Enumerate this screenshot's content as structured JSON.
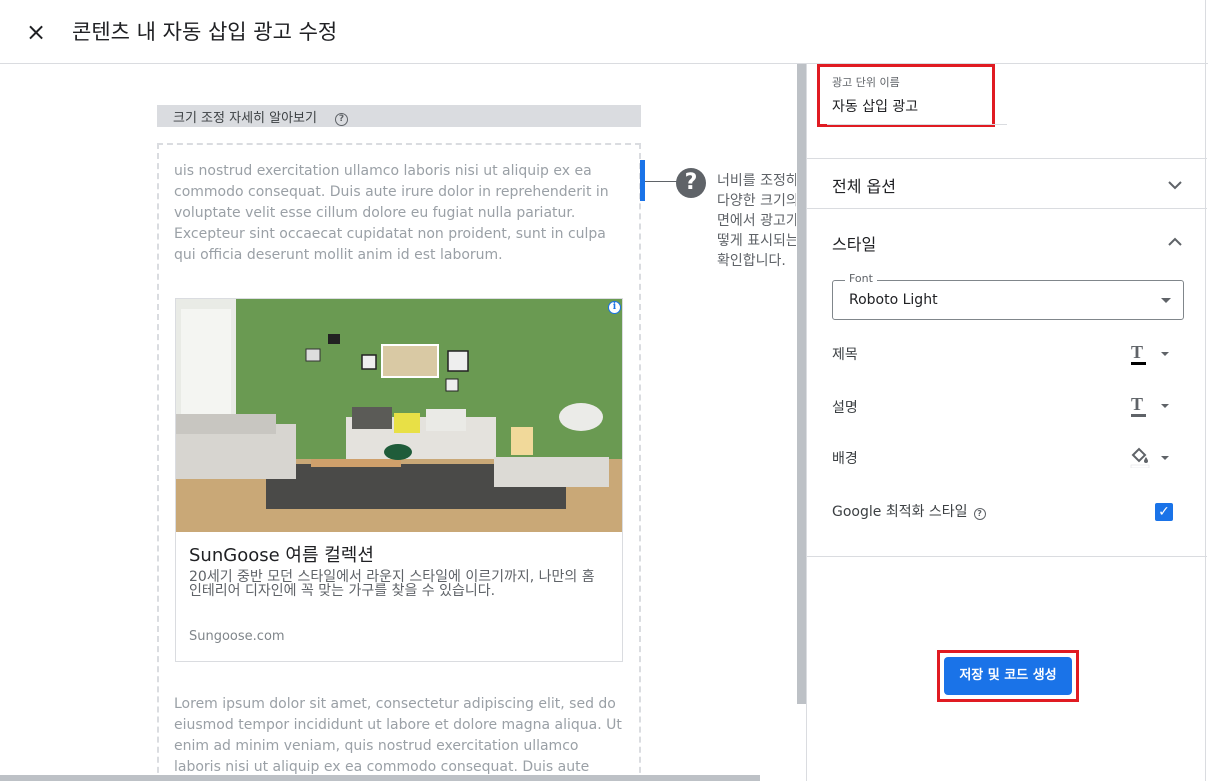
{
  "header": {
    "title": "콘텐츠 내 자동 삽입 광고 수정",
    "close_icon": "×"
  },
  "preview": {
    "resize_link": "크기 조정 자세히 알아보기",
    "lorem_top": "uis nostrud exercitation ullamco laboris nisi ut aliquip ex ea commodo consequat. Duis aute irure dolor in reprehenderit in voluptate velit esse cillum dolore eu fugiat nulla pariatur. Excepteur sint occaecat cupidatat non proident, sunt in culpa qui officia deserunt mollit anim id est laborum.",
    "lorem_bottom": "Lorem ipsum dolor sit amet, consectetur adipiscing elit, sed do eiusmod tempor incididunt ut labore et dolore magna aliqua. Ut enim ad minim veniam, quis nostrud exercitation ullamco laboris nisi ut aliquip ex ea commodo consequat. Duis aute irure dolor in",
    "ad": {
      "title": "SunGoose 여름 컬렉션",
      "description": "20세기 중반 모던 스타일에서 라운지 스타일에 이르기까지, 나만의 홈 인테리어 디자인에 꼭 맞는 가구를 찾을 수 있습니다.",
      "url": "Sungoose.com",
      "info_icon": "i"
    },
    "hint_lines": [
      "너비를 조정하",
      "다양한 크기의",
      "면에서 광고가",
      "떻게 표시되는",
      "확인합니다."
    ],
    "hint_icon": "?"
  },
  "panel": {
    "ad_unit_name_label": "광고 단위 이름",
    "ad_unit_name_value": "자동 삽입 광고",
    "section_general": "전체 옵션",
    "section_style": "스타일",
    "font_label": "Font",
    "font_value": "Roboto Light",
    "row_title": "제목",
    "row_description": "설명",
    "row_background": "배경",
    "google_optimized": "Google 최적화 스타일",
    "google_optimized_checked": true,
    "help_icon": "?",
    "t_glyph": "T",
    "title_color": "#000000",
    "description_color": "#5f6368",
    "background_color": "#ffffff",
    "save_button": "저장 및 코드 생성",
    "check_glyph": "✓"
  },
  "colors": {
    "accent": "#1a73e8",
    "highlight_border": "#e01b22"
  }
}
